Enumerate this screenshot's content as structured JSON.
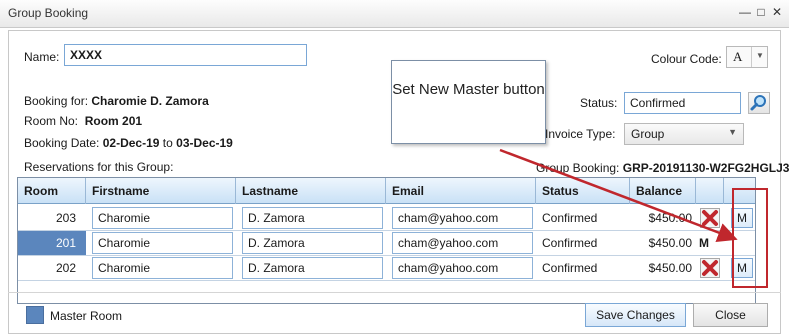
{
  "window": {
    "title": "Group Booking"
  },
  "form": {
    "name_label": "Name:",
    "name_value": "XXXX",
    "colour_code_label": "Colour Code:",
    "colour_code_value": "A",
    "booking_for_label": "Booking for:",
    "booking_for_value": "Charomie D. Zamora",
    "room_no_label": "Room No:",
    "room_no_value": "Room 201",
    "booking_date_label": "Booking Date:",
    "booking_date_from": "02-Dec-19",
    "booking_date_to_label": "to",
    "booking_date_to": "03-Dec-19",
    "status_label": "Status:",
    "status_value": "Confirmed",
    "invoice_type_label": "Invoice Type:",
    "invoice_type_value": "Group",
    "reservations_label": "Reservations for this Group:",
    "group_booking_label": "Group Booking:",
    "group_booking_value": "GRP-20191130-W2FG2HGLJ3"
  },
  "grid": {
    "headers": [
      "Room",
      "Firstname",
      "Lastname",
      "Email",
      "Status",
      "Balance"
    ],
    "rows": [
      {
        "room": "203",
        "firstname": "Charomie",
        "lastname": "D. Zamora",
        "email": "cham@yahoo.com",
        "status": "Confirmed",
        "balance": "$450.00",
        "master_label": "M"
      },
      {
        "room": "201",
        "firstname": "Charomie",
        "lastname": "D. Zamora",
        "email": "cham@yahoo.com",
        "status": "Confirmed",
        "balance": "$450.00",
        "master_marker": "M"
      },
      {
        "room": "202",
        "firstname": "Charomie",
        "lastname": "D. Zamora",
        "email": "cham@yahoo.com",
        "status": "Confirmed",
        "balance": "$450.00",
        "master_label": "M"
      }
    ]
  },
  "callout": {
    "text": "Set New Master button"
  },
  "footer": {
    "legend_label": "Master Room",
    "save_label": "Save Changes",
    "close_label": "Close"
  },
  "colors": {
    "master_room": "#5b86bd",
    "highlight": "#c0272d",
    "header_bg": "#c9e1f6"
  }
}
